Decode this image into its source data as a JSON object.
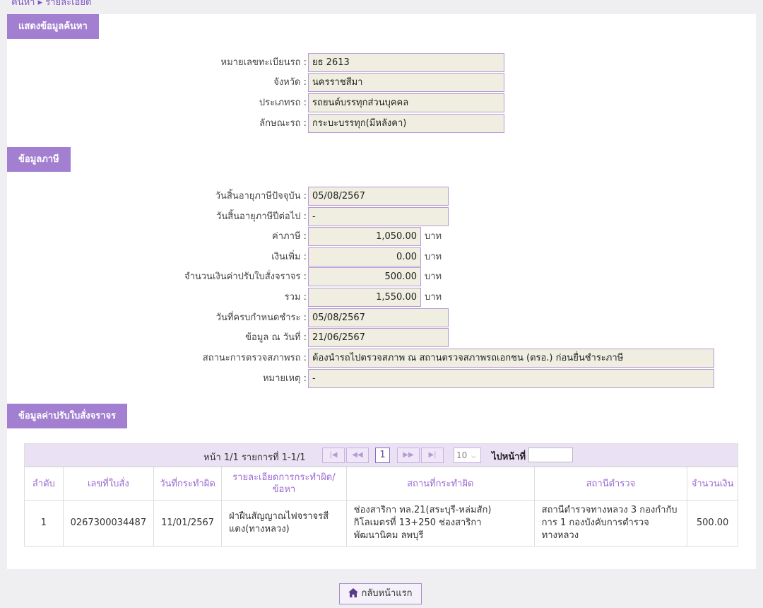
{
  "breadcrumb": {
    "home": "ค้นหา",
    "separator": "▸",
    "current": "รายละเอียด"
  },
  "sections": {
    "search_info": "แสดงข้อมูลค้นหา",
    "tax_info": "ข้อมูลภาษี",
    "fines": "ข้อมูลค่าปรับใบสั่งจราจร"
  },
  "vehicle": {
    "plate": {
      "label": "หมายเลขทะเบียนรถ :",
      "value": "ยธ 2613"
    },
    "province": {
      "label": "จังหวัด :",
      "value": "นครราชสีมา"
    },
    "type": {
      "label": "ประเภทรถ :",
      "value": "รถยนต์บรรทุกส่วนบุคคล"
    },
    "style": {
      "label": "ลักษณะรถ :",
      "value": "กระบะบรรทุก(มีหลังคา)"
    }
  },
  "tax": {
    "expiry_current": {
      "label": "วันสิ้นอายุภาษีปัจจุบัน :",
      "value": "05/08/2567"
    },
    "expiry_next": {
      "label": "วันสิ้นอายุภาษีปีต่อไป :",
      "value": "-"
    },
    "tax_amount": {
      "label": "ค่าภาษี :",
      "value": "1,050.00",
      "unit": "บาท"
    },
    "surcharge": {
      "label": "เงินเพิ่ม :",
      "value": "0.00",
      "unit": "บาท"
    },
    "fine_amount": {
      "label": "จำนวนเงินค่าปรับใบสั่งจราจร :",
      "value": "500.00",
      "unit": "บาท"
    },
    "total": {
      "label": "รวม :",
      "value": "1,550.00",
      "unit": "บาท"
    },
    "due_date": {
      "label": "วันที่ครบกำหนดชำระ :",
      "value": "05/08/2567"
    },
    "as_of": {
      "label": "ข้อมูล ณ วันที่ :",
      "value": "21/06/2567"
    },
    "inspection": {
      "label": "สถานะการตรวจสภาพรถ :",
      "value": "ต้องนำรถไปตรวจสภาพ ณ สถานตรวจสภาพรถเอกชน (ตรอ.) ก่อนยื่นชำระภาษี"
    },
    "remark": {
      "label": "หมายเหตุ :",
      "value": "-"
    }
  },
  "pager": {
    "summary": "หน้า 1/1 รายการที่ 1-1/1",
    "first": "|◀",
    "prev": "◀◀",
    "current_page": "1",
    "next": "▶▶",
    "last": "▶|",
    "page_size": "10",
    "goto_label": "ไปหน้าที่"
  },
  "table": {
    "headers": [
      "ลำดับ",
      "เลขที่ใบสั่ง",
      "วันที่กระทำผิด",
      "รายละเอียดการกระทำผิด/ข้อหา",
      "สถานที่กระทำผิด",
      "สถานีตำรวจ",
      "จำนวนเงิน"
    ],
    "rows": [
      {
        "seq": "1",
        "ticket_no": "0267300034487",
        "date": "11/01/2567",
        "offense": "ฝ่าฝืนสัญญาณไฟจราจรสีแดง(ทางหลวง)",
        "location": "ช่องสาริกา ทล.21(สระบุรี-หล่มสัก) กิโลเมตรที่ 13+250 ช่องสาริกา พัฒนานิคม ลพบุรี",
        "station": "สถานีตำรวจทางหลวง 3 กองกำกับการ 1 กองบังคับการตำรวจทางหลวง",
        "amount": "500.00"
      }
    ]
  },
  "home_button": "กลับหน้าแรก",
  "colors": {
    "header_bg": "#a27fd0",
    "field_bg": "#efeee0",
    "field_border": "#b79ad7",
    "accent": "#7e57c2"
  }
}
